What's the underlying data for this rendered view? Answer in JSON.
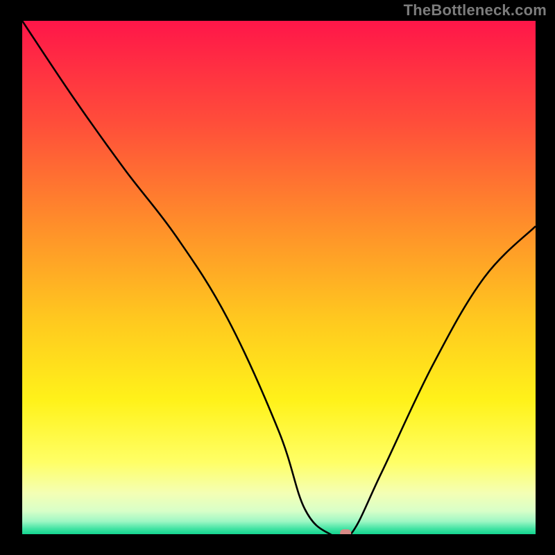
{
  "watermark": "TheBottleneck.com",
  "chart_data": {
    "type": "line",
    "title": "",
    "xlabel": "",
    "ylabel": "",
    "xlim": [
      0,
      100
    ],
    "ylim": [
      0,
      100
    ],
    "x": [
      0,
      10,
      20,
      30,
      40,
      50,
      55,
      60,
      64,
      70,
      80,
      90,
      100
    ],
    "values": [
      100,
      85,
      71,
      58,
      42,
      20,
      5,
      0,
      0,
      12,
      33,
      50,
      60
    ],
    "marker": {
      "x": 63,
      "y": 0
    },
    "background_type": "vertical_gradient",
    "gradient_stops": [
      {
        "pos": 0.0,
        "color": "#ff1649"
      },
      {
        "pos": 0.2,
        "color": "#ff4e3a"
      },
      {
        "pos": 0.4,
        "color": "#ff8f2a"
      },
      {
        "pos": 0.58,
        "color": "#ffc81f"
      },
      {
        "pos": 0.74,
        "color": "#fff21a"
      },
      {
        "pos": 0.86,
        "color": "#ffff66"
      },
      {
        "pos": 0.92,
        "color": "#f4ffb4"
      },
      {
        "pos": 0.955,
        "color": "#d8ffc8"
      },
      {
        "pos": 0.975,
        "color": "#9ef7c4"
      },
      {
        "pos": 0.99,
        "color": "#3fe3a2"
      },
      {
        "pos": 1.0,
        "color": "#14d48f"
      }
    ],
    "curve_color": "#000000",
    "marker_color": "#d88a86"
  }
}
